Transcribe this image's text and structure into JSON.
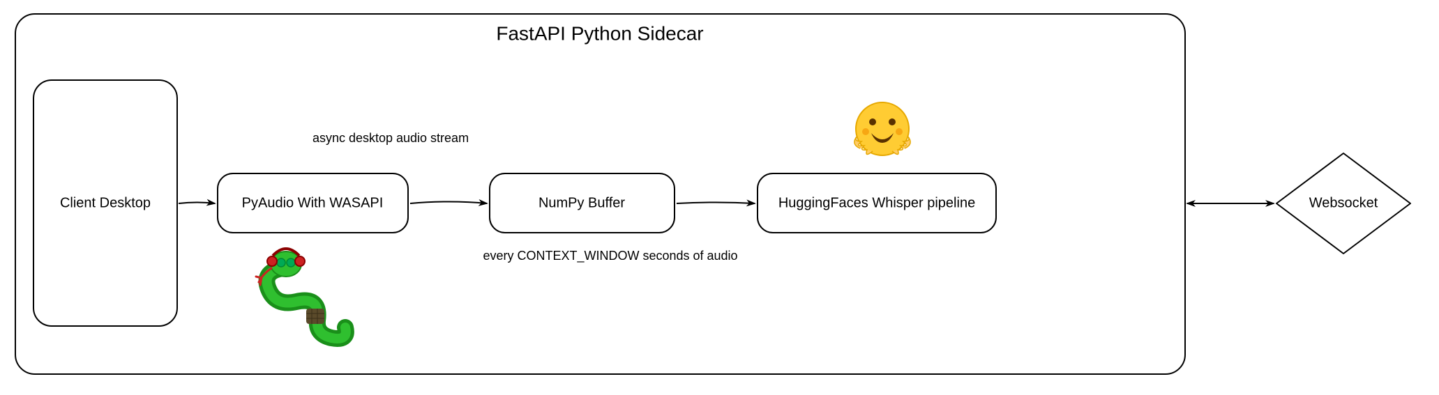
{
  "container": {
    "title": "FastAPI Python Sidecar"
  },
  "nodes": {
    "client": "Client Desktop",
    "pyaudio": "PyAudio With WASAPI",
    "numpy": "NumPy Buffer",
    "whisper": "HuggingFaces Whisper pipeline",
    "websocket": "Websocket"
  },
  "edges": {
    "audio_stream": "async desktop audio stream",
    "context_window": "every CONTEXT_WINDOW seconds of audio"
  },
  "icons": {
    "huggingface": "huggingface-logo-icon",
    "python_snake": "python-snake-headphones-icon"
  }
}
